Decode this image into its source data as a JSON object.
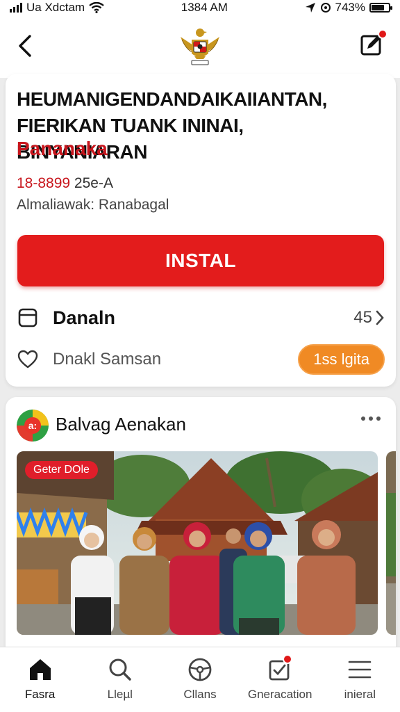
{
  "status_bar": {
    "carrier": "Ua Xdctam",
    "time": "1384 AM",
    "battery": "743%",
    "battery_level": 0.74
  },
  "header": {
    "back_icon": "chevron-left-icon",
    "emblem_icon": "garuda-emblem-icon",
    "edit_icon": "edit-square-icon",
    "edit_badge_color": "#e01818"
  },
  "app": {
    "title_line1": "HEUMANIGENDANDAIKAIIANTAN,",
    "title_line2": "FIERIKAN TUANK ININAI, BINYANIARAN",
    "subtitle": "Pananaka",
    "meta_red": "18-8899",
    "meta_dark": "25e-A",
    "meta_line2": "Almaliawak: Ranabagal",
    "install_label": "INSTAL",
    "accent_color": "#e31c1c"
  },
  "rows": {
    "download": {
      "icon": "storage-icon",
      "label": "Danaln",
      "count": "45"
    },
    "favorite": {
      "icon": "heart-icon",
      "label": "Dnakl Samsan",
      "pill_label": "1ss lgita",
      "pill_color": "#f08a24"
    }
  },
  "post": {
    "author": "Balvag Aenakan",
    "avatar_text": "a:",
    "image_badge": "Geter DOle",
    "more_icon": "more-horizontal-icon"
  },
  "bottom_nav": [
    {
      "label": "Fasra",
      "icon": "home-icon",
      "active": true
    },
    {
      "label": "Lleµl",
      "icon": "search-icon",
      "active": false
    },
    {
      "label": "Cllans",
      "icon": "steering-wheel-icon",
      "active": false
    },
    {
      "label": "Gneracation",
      "icon": "check-box-icon",
      "active": false,
      "badge": true
    },
    {
      "label": "inieral",
      "icon": "menu-icon",
      "active": false
    }
  ]
}
